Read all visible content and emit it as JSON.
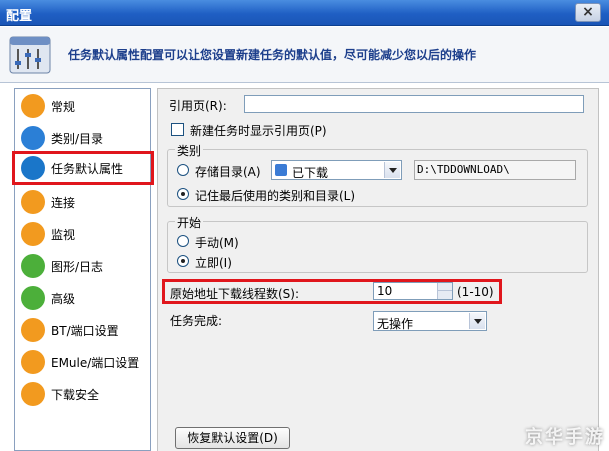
{
  "window": {
    "title": "配置",
    "close_label": "×"
  },
  "header": {
    "text": "任务默认属性配置可以让您设置新建任务的默认值，尽可能减少您以后的操作"
  },
  "sidebar": {
    "items": [
      {
        "label": "常规",
        "icon": "user-icon",
        "color": "#f29a1f"
      },
      {
        "label": "类别/目录",
        "icon": "folder-icon",
        "color": "#2b7fd6"
      },
      {
        "label": "任务默认属性",
        "icon": "asterisk-icon",
        "color": "#1a76c9"
      },
      {
        "label": "连接",
        "icon": "connect-icon",
        "color": "#f29a1f"
      },
      {
        "label": "监视",
        "icon": "monitor-icon",
        "color": "#f29a1f"
      },
      {
        "label": "图形/日志",
        "icon": "chart-icon",
        "color": "#4caf3a"
      },
      {
        "label": "高级",
        "icon": "gear-icon",
        "color": "#4caf3a"
      },
      {
        "label": "BT/端口设置",
        "icon": "bt-icon",
        "color": "#f29a1f"
      },
      {
        "label": "EMule/端口设置",
        "icon": "emule-icon",
        "color": "#f29a1f"
      },
      {
        "label": "下载安全",
        "icon": "shield-icon",
        "color": "#f29a1f"
      }
    ],
    "selected_index": 2
  },
  "form": {
    "referer_label": "引用页(R):",
    "referer_value": "",
    "show_referer_label": "新建任务时显示引用页(P)",
    "category_group": "类别",
    "save_dir_label": "存储目录(A)",
    "category_value": "已下载",
    "path_value": "D:\\TDDOWNLOAD\\",
    "remember_label": "记住最后使用的类别和目录(L)",
    "start_group": "开始",
    "manual_label": "手动(M)",
    "immediate_label": "立即(I)",
    "threads_label": "原始地址下载线程数(S):",
    "threads_value": "10",
    "threads_range": "(1-10)",
    "on_complete_label": "任务完成:",
    "on_complete_value": "无操作",
    "restore_button": "恢复默认设置(D)"
  },
  "watermark": "京华手游"
}
